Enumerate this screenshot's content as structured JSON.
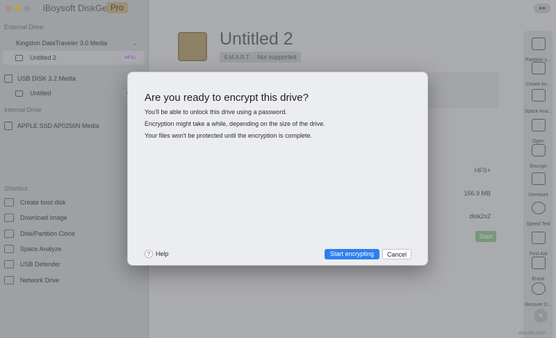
{
  "app": {
    "title": "iBoysoft DiskGeeker",
    "badge": "Pro"
  },
  "sidebar": {
    "external_label": "External Drive",
    "internal_label": "Internal Drive",
    "shortcut_label": "Shortcut",
    "external_drives": [
      {
        "name": "Kingston DataTraveler 3.0 Media",
        "volumes": [
          {
            "name": "Untitled 2",
            "fs": "HFS+",
            "selected": true
          }
        ]
      },
      {
        "name": "USB DISK 3.2 Media",
        "volumes": [
          {
            "name": "Untitled",
            "fs": "BitLo",
            "selected": false
          }
        ]
      }
    ],
    "internal_drives": [
      {
        "name": "APPLE SSD AP0256N Media"
      }
    ],
    "shortcuts": [
      "Create boot disk",
      "Download Image",
      "Disk/Partition Clone",
      "Space Analyze",
      "USB Defender",
      "Network Drive"
    ]
  },
  "main": {
    "drive_title": "Untitled 2",
    "smart_label": "S.M.A.R.T",
    "smart_value": "Not supported",
    "info_values": [
      "HFS+",
      "156.9 MB",
      "disk2s2"
    ],
    "start_label": "Start"
  },
  "toolbar": {
    "items": [
      "Partition c...",
      "Create bo...",
      "Space Ana...",
      "Open",
      "Encrypt",
      "Unmount",
      "Speed Test",
      "First Aid",
      "Erase",
      "Recover D..."
    ]
  },
  "dialog": {
    "title": "Are you ready to encrypt this drive?",
    "lines": [
      "You'll be able to unlock this drive using a password.",
      "Encryption might take a while, depending on the size of the drive.",
      "Your files won't be protected until the encryption is complete."
    ],
    "help_label": "Help",
    "primary_label": "Start encrypting",
    "cancel_label": "Cancel"
  },
  "watermark": "wsxdn.com",
  "colors": {
    "accent": "#2f7ff0",
    "pro_badge": "#b6a27a",
    "start_button": "#86ad84"
  }
}
